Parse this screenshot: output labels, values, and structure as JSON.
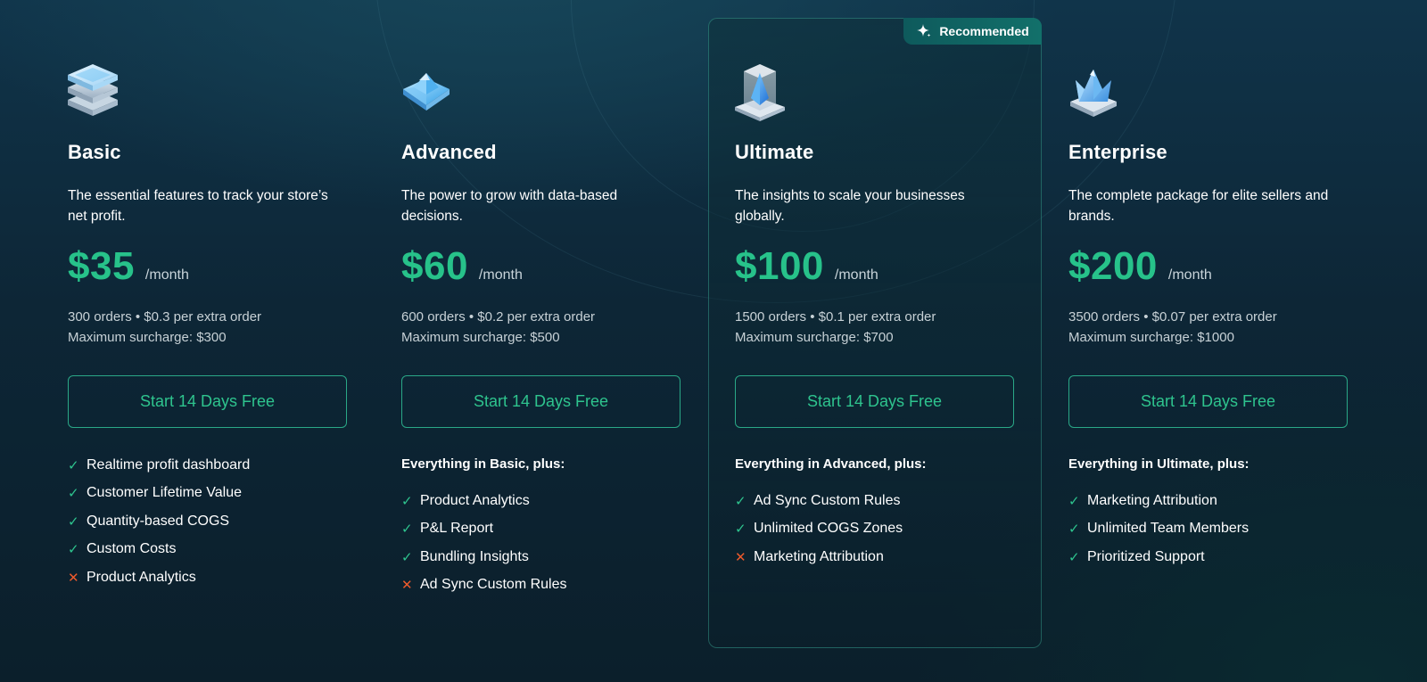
{
  "colors": {
    "accent": "#27c28a",
    "accent_border": "#2aa887",
    "cross": "#ee5a2c",
    "background": "#0c2230",
    "badge": "#12706a"
  },
  "badge": {
    "label": "Recommended",
    "icon": "sparkle-icon"
  },
  "plans": [
    {
      "name": "Basic",
      "icon": "stack-icon",
      "description": "The essential features to track your store’s net profit.",
      "price": "$35",
      "period": "/month",
      "orders_line": "300 orders • $0.3 per extra order",
      "surcharge_line": "Maximum surcharge: $300",
      "cta": "Start 14 Days Free",
      "features_heading": "",
      "features": [
        {
          "label": "Realtime profit dashboard",
          "included": true,
          "mark": "✓"
        },
        {
          "label": "Customer Lifetime Value",
          "included": true,
          "mark": "✓"
        },
        {
          "label": "Quantity-based COGS",
          "included": true,
          "mark": "✓"
        },
        {
          "label": "Custom Costs",
          "included": true,
          "mark": "✓"
        },
        {
          "label": "Product Analytics",
          "included": false,
          "mark": "✕"
        }
      ]
    },
    {
      "name": "Advanced",
      "icon": "gem-icon",
      "description": "The power to grow with data-based decisions.",
      "price": "$60",
      "period": "/month",
      "orders_line": "600 orders • $0.2 per extra order",
      "surcharge_line": "Maximum surcharge: $500",
      "cta": "Start 14 Days Free",
      "features_heading": "Everything in Basic, plus:",
      "features": [
        {
          "label": "Product Analytics",
          "included": true,
          "mark": "✓"
        },
        {
          "label": "P&L Report",
          "included": true,
          "mark": "✓"
        },
        {
          "label": "Bundling Insights",
          "included": true,
          "mark": "✓"
        },
        {
          "label": "Ad Sync Custom Rules",
          "included": false,
          "mark": "✕"
        }
      ]
    },
    {
      "name": "Ultimate",
      "icon": "crystal-cube-icon",
      "description": "The insights to scale your businesses globally.",
      "price": "$100",
      "period": "/month",
      "orders_line": "1500 orders • $0.1 per extra order",
      "surcharge_line": "Maximum surcharge: $700",
      "cta": "Start 14 Days Free",
      "features_heading": "Everything in Advanced, plus:",
      "features": [
        {
          "label": "Ad Sync Custom Rules",
          "included": true,
          "mark": "✓"
        },
        {
          "label": "Unlimited COGS Zones",
          "included": true,
          "mark": "✓"
        },
        {
          "label": "Marketing Attribution",
          "included": false,
          "mark": "✕"
        }
      ]
    },
    {
      "name": "Enterprise",
      "icon": "crown-icon",
      "description": "The complete package for elite sellers and brands.",
      "price": "$200",
      "period": "/month",
      "orders_line": "3500 orders • $0.07 per extra order",
      "surcharge_line": "Maximum surcharge: $1000",
      "cta": "Start 14 Days Free",
      "features_heading": "Everything in Ultimate, plus:",
      "features": [
        {
          "label": "Marketing Attribution",
          "included": true,
          "mark": "✓"
        },
        {
          "label": "Unlimited Team Members",
          "included": true,
          "mark": "✓"
        },
        {
          "label": "Prioritized Support",
          "included": true,
          "mark": "✓"
        }
      ]
    }
  ]
}
